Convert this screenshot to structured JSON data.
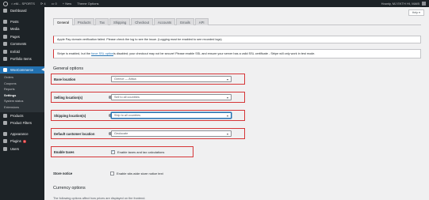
{
  "adminbar": {
    "site_name": "eM... SPORTS",
    "updates_count": "4",
    "comments_count": "0",
    "new_label": "+ New",
    "theme_options": "Theme Options",
    "howdy": "Howdy, MJ EKTH HI, MAIB"
  },
  "sidebar": {
    "items": [
      {
        "label": "Dashboard",
        "icon": "dashboard-icon"
      },
      {
        "label": "Posts",
        "icon": "pin-icon"
      },
      {
        "label": "Media",
        "icon": "media-icon"
      },
      {
        "label": "Pages",
        "icon": "page-icon"
      },
      {
        "label": "Comments",
        "icon": "comment-icon"
      },
      {
        "label": "Enfold",
        "icon": "enfold-icon"
      },
      {
        "label": "Portfolio Items",
        "icon": "portfolio-icon"
      }
    ],
    "woocommerce": {
      "label": "WooCommerce",
      "icon": "woocommerce-icon"
    },
    "submenu": [
      "Orders",
      "Coupons",
      "Reports",
      "Settings",
      "System status",
      "Extensions"
    ],
    "current_submenu": "Settings",
    "items_after": [
      {
        "label": "Products",
        "icon": "products-icon"
      },
      {
        "label": "Product Filters",
        "icon": "filter-icon"
      }
    ],
    "items_bottom": [
      {
        "label": "Appearance",
        "icon": "appearance-icon"
      },
      {
        "label": "Plugins",
        "icon": "plugins-icon",
        "badge": "5"
      },
      {
        "label": "Users",
        "icon": "users-icon"
      }
    ]
  },
  "help_button": "Help ▾",
  "tabs": [
    "General",
    "Products",
    "Tax",
    "Shipping",
    "Checkout",
    "Accounts",
    "Emails",
    "API"
  ],
  "active_tab": "General",
  "notices": {
    "apple_pay": "Apple Pay domain verification failed. Please check the log to see the issue. (Logging must be enabled to see recorded logs)",
    "stripe_pre": "Stripe is enabled, but the ",
    "stripe_link": "force SSL option",
    "stripe_post": " is disabled; your checkout may not be secure! Please enable SSL and ensure your server has a valid SSL certificate - Stripe will only work in test mode."
  },
  "general_heading": "General options",
  "fields": {
    "base_location": {
      "label": "Base location",
      "value": "Greece — Attica"
    },
    "selling_locations": {
      "label": "Selling location(s)",
      "value": "Sell to all countries"
    },
    "shipping_locations": {
      "label": "Shipping location(s)",
      "value": "Ship to all countries"
    },
    "default_customer_location": {
      "label": "Default customer location",
      "value": "Geolocate"
    },
    "enable_taxes": {
      "label": "Enable taxes",
      "checkbox_label": "Enable taxes and tax calculations",
      "checked": true
    },
    "store_notice": {
      "label": "Store notice",
      "checkbox_label": "Enable site-wide store notice text",
      "checked": false
    }
  },
  "currency_heading": "Currency options",
  "currency_desc": "The following options affect how prices are displayed on the frontend.",
  "colors": {
    "accent": "#2271b1",
    "highlight": "#d63638",
    "sidebar": "#1d2327"
  }
}
